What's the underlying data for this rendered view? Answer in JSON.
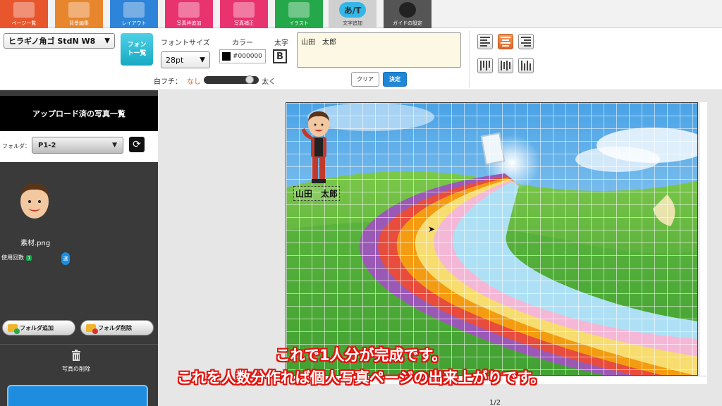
{
  "toolbar": {
    "items": [
      {
        "label": "ページ一覧",
        "color": "#e8562e",
        "icon": "pages-icon"
      },
      {
        "label": "背景編集",
        "color": "#e8862e",
        "icon": "background-icon"
      },
      {
        "label": "レイアウト",
        "color": "#2e84d8",
        "icon": "layout-icon"
      },
      {
        "label": "写真枠追加",
        "color": "#e8336f",
        "icon": "photo-frame-icon"
      },
      {
        "label": "写真補正",
        "color": "#e8336f",
        "icon": "photo-fix-icon"
      },
      {
        "label": "イラスト",
        "color": "#25a84a",
        "icon": "illustration-icon"
      },
      {
        "label": "文字追加",
        "color": "#d0d0d0",
        "icon": "text-add-icon",
        "badge": "あ/T"
      },
      {
        "label": "ガイドの設定",
        "color": "#555555",
        "icon": "guide-icon"
      }
    ]
  },
  "fontbar": {
    "font_family": "ヒラギノ角ゴ StdN W8",
    "font_button": "フォント一覧",
    "size_label": "フォントサイズ",
    "size_value": "28pt",
    "color_label": "カラー",
    "color_value": "#000000",
    "bold_label": "太字",
    "bold_button": "B",
    "text_value": "山田　太郎",
    "outline_label": "白フチ：",
    "outline_none": "なし",
    "outline_thick": "太く",
    "outline_level": 0.9,
    "clear_button": "クリア",
    "ok_button": "決定"
  },
  "left_panel": {
    "title": "アップロード済の写真一覧",
    "folder_label": "フォルダ：",
    "folder_value": "P1-2",
    "photo_name": "素材.png",
    "usage_label": "使用回数",
    "usage_count": "1",
    "usage_badge": "選",
    "add_folder": "フォルダ追加",
    "delete_folder": "フォルダ削除",
    "delete_photo": "写真の削除"
  },
  "canvas": {
    "name_text": "山田　太郎",
    "page_indicator": "1/2"
  },
  "caption": {
    "line1": "これで1人分が完成です。",
    "line2": "これを人数分作れば個人写真ページの出来上がりです。"
  }
}
